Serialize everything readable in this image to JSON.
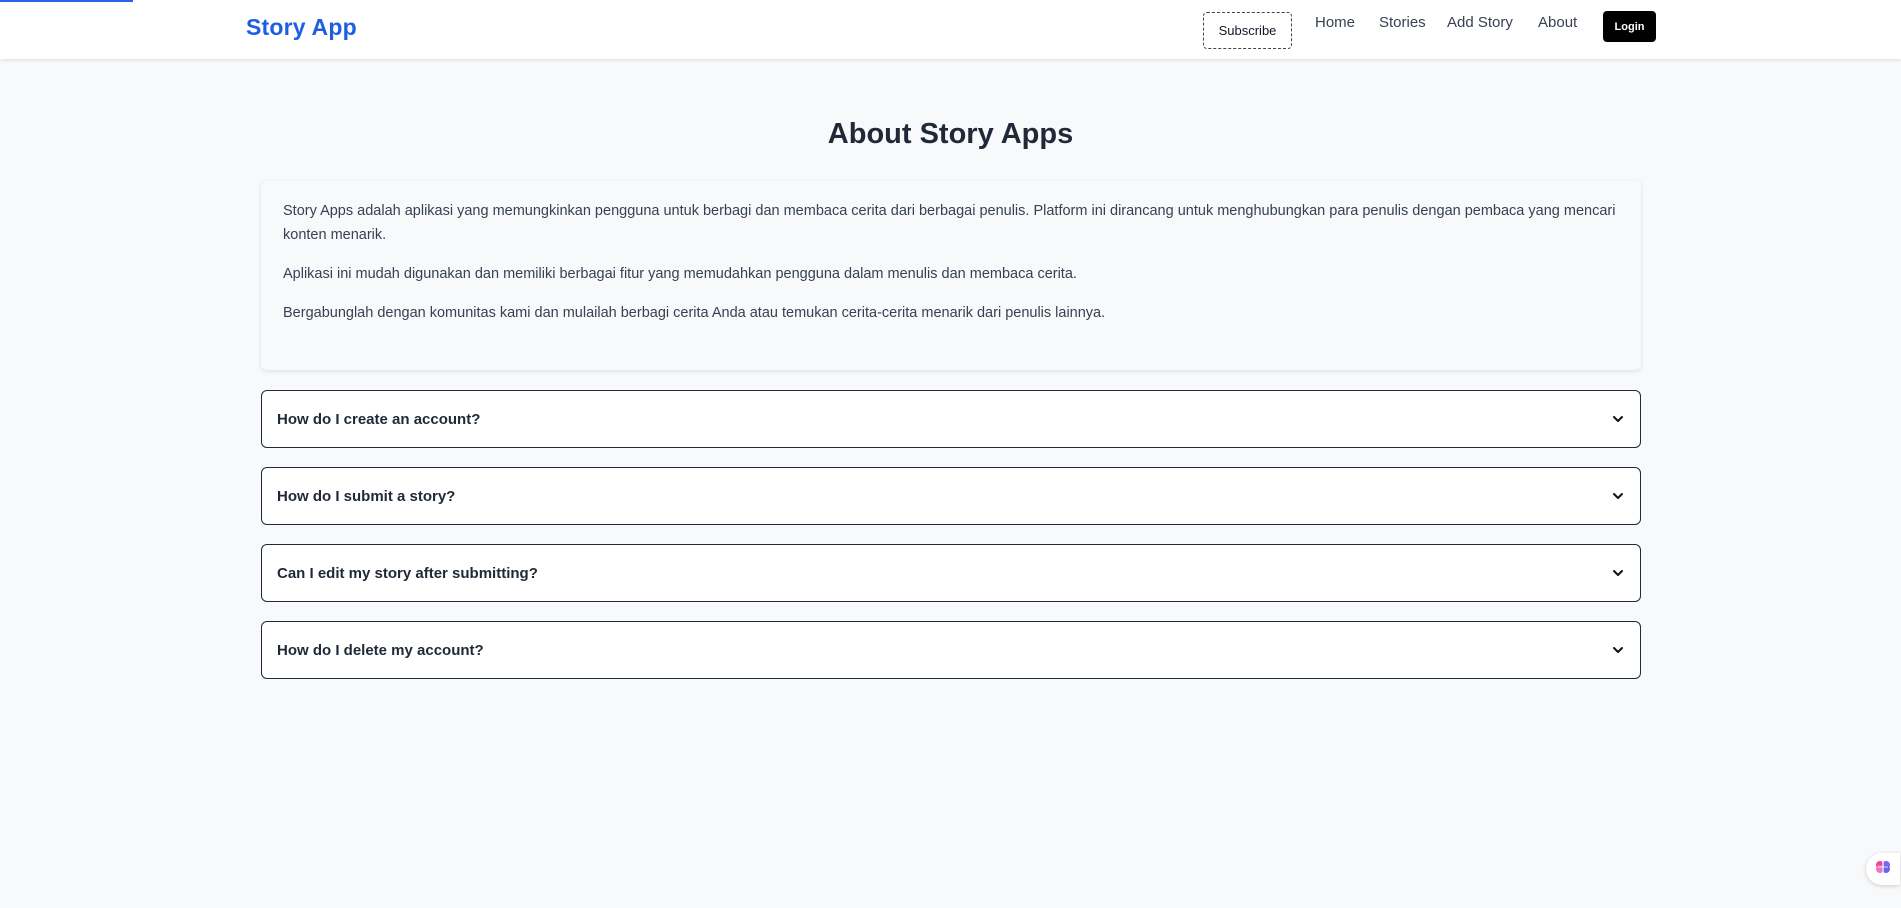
{
  "header": {
    "brand": "Story App",
    "subscribe_label": "Subscribe",
    "nav": [
      "Home",
      "Stories",
      "Add Story",
      "About"
    ],
    "login_label": "Login"
  },
  "page": {
    "title": "About Story Apps",
    "paragraphs": [
      "Story Apps adalah aplikasi yang memungkinkan pengguna untuk berbagi dan membaca cerita dari berbagai penulis. Platform ini dirancang untuk menghubungkan para penulis dengan pembaca yang mencari konten menarik.",
      "Aplikasi ini mudah digunakan dan memiliki berbagai fitur yang memudahkan pengguna dalam menulis dan membaca cerita.",
      "Bergabunglah dengan komunitas kami dan mulailah berbagi cerita Anda atau temukan cerita-cerita menarik dari penulis lainnya."
    ]
  },
  "faq": [
    {
      "question": "How do I create an account?",
      "icon": "chevron-down-icon"
    },
    {
      "question": "How do I submit a story?",
      "icon": "chevron-down-icon"
    },
    {
      "question": "Can I edit my story after submitting?",
      "icon": "chevron-down-icon"
    },
    {
      "question": "How do I delete my account?",
      "icon": "chevron-down-icon"
    }
  ],
  "colors": {
    "brand": "#1d5fe0",
    "background": "#f8f9fb",
    "login_bg": "#000000",
    "progress": "#2563eb"
  },
  "widgets": {
    "assistant_icon": "brain-icon"
  }
}
